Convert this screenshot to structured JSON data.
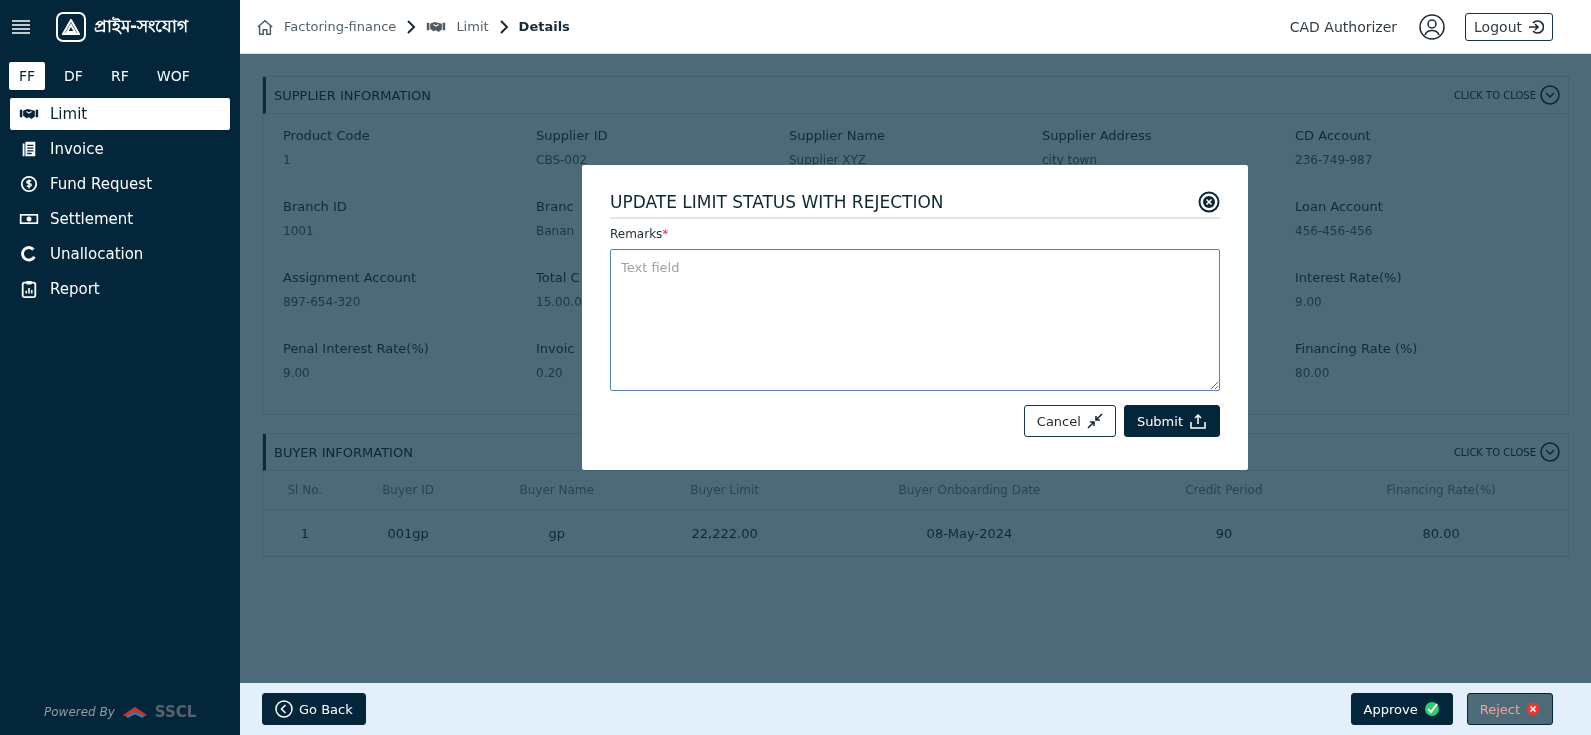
{
  "sidebar": {
    "logo_text": "প্রাইম-সংযোগ",
    "product_tabs": [
      {
        "label": "FF",
        "selected": true
      },
      {
        "label": "DF",
        "selected": false
      },
      {
        "label": "RF",
        "selected": false
      },
      {
        "label": "WOF",
        "selected": false
      }
    ],
    "menu": [
      {
        "label": "Limit",
        "kind": "handshake",
        "selected": true
      },
      {
        "label": "Invoice",
        "kind": "document",
        "selected": false
      },
      {
        "label": "Fund Request",
        "kind": "coin",
        "selected": false
      },
      {
        "label": "Settlement",
        "kind": "banknote",
        "selected": false
      },
      {
        "label": "Unallocation",
        "kind": "ring",
        "selected": false
      },
      {
        "label": "Report",
        "kind": "clipboard",
        "selected": false
      }
    ],
    "powered_by": "Powered By",
    "brand": "SSCL"
  },
  "header": {
    "breadcrumbs": [
      {
        "label": "Factoring-finance",
        "kind": "home"
      },
      {
        "label": "Limit",
        "kind": "handshake"
      },
      {
        "label": "Details",
        "kind": "current"
      }
    ],
    "user": "CAD Authorizer",
    "logout": "Logout"
  },
  "supplier_section": {
    "title": "SUPPLIER INFORMATION",
    "toggle": "CLICK TO CLOSE",
    "rows": [
      [
        {
          "label": "Product Code",
          "value": "1"
        },
        {
          "label": "Supplier ID",
          "value": "CBS-002"
        },
        {
          "label": "Supplier Name",
          "value": "Supplier XYZ"
        },
        {
          "label": "Supplier Address",
          "value": "city town"
        },
        {
          "label": "CD Account",
          "value": "236-749-987"
        }
      ],
      [
        {
          "label": "Branch ID",
          "value": "1001"
        },
        {
          "label": "Branc",
          "value": "Banan"
        },
        {
          "label": "Loan Account",
          "value": "456-456-456"
        }
      ],
      [
        {
          "label": "Assignment Account",
          "value": "897-654-320"
        },
        {
          "label": "Total C",
          "value": "15.00.0"
        },
        {
          "label": "Interest Rate(%)",
          "value": "9.00"
        }
      ],
      [
        {
          "label": "Penal Interest Rate(%)",
          "value": "9.00"
        },
        {
          "label": "Invoic",
          "value": "0.20"
        },
        {
          "label": "Financing Rate (%)",
          "value": "80.00"
        }
      ]
    ]
  },
  "buyer_section": {
    "title": "BUYER INFORMATION",
    "toggle": "CLICK TO CLOSE",
    "columns": [
      "Sl No.",
      "Buyer ID",
      "Buyer Name",
      "Buyer Limit",
      "Buyer Onboarding Date",
      "Credit Period",
      "Financing Rate(%)"
    ],
    "rows": [
      [
        "1",
        "001gp",
        "gp",
        "22,222.00",
        "08-May-2024",
        "90",
        "80.00"
      ]
    ]
  },
  "modal": {
    "title": "UPDATE LIMIT STATUS WITH REJECTION",
    "field_label": "Remarks",
    "required_mark": "*",
    "placeholder": "Text field",
    "cancel": "Cancel",
    "submit": "Submit"
  },
  "footer": {
    "go_back": "Go Back",
    "approve": "Approve",
    "reject": "Reject"
  }
}
